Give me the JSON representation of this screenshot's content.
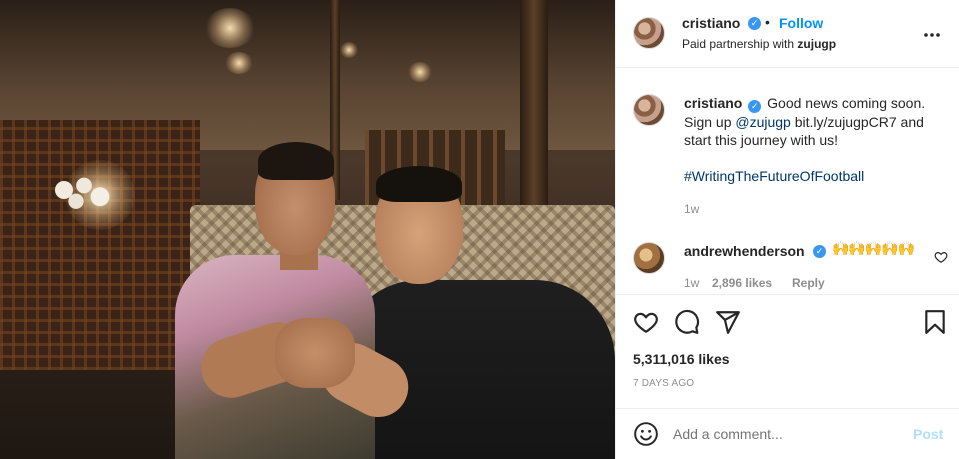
{
  "post": {
    "author": "cristiano",
    "follow_label": "Follow",
    "separator": "•",
    "partnership_prefix": "Paid partnership with ",
    "partner": "zujugp",
    "more_label": "•••"
  },
  "caption": {
    "author": "cristiano",
    "text_1": "Good news coming soon. Sign up ",
    "mention": "@zujugp",
    "text_2": " bit.ly/zujugpCR7 and start this journey with us!",
    "hashtag": "#WritingTheFutureOfFootball",
    "time": "1w"
  },
  "comment": {
    "author": "andrewhenderson",
    "emojis": "🙌🙌🙌🙌🙌",
    "time": "1w",
    "likes": "2,896 likes",
    "reply": "Reply"
  },
  "stats": {
    "likes": "5,311,016 likes",
    "posted": "7 DAYS AGO"
  },
  "composer": {
    "placeholder": "Add a comment...",
    "post_label": "Post"
  },
  "icons": {
    "verified": "verified-badge-icon",
    "like": "heart-icon",
    "comment": "comment-bubble-icon",
    "share": "paper-plane-icon",
    "save": "bookmark-icon",
    "emoji": "smiley-icon"
  },
  "colors": {
    "accent": "#0095f6",
    "link": "#00376b",
    "verified": "#3897f0",
    "muted": "#8e8e8e",
    "post_disabled": "#b2dffc"
  }
}
